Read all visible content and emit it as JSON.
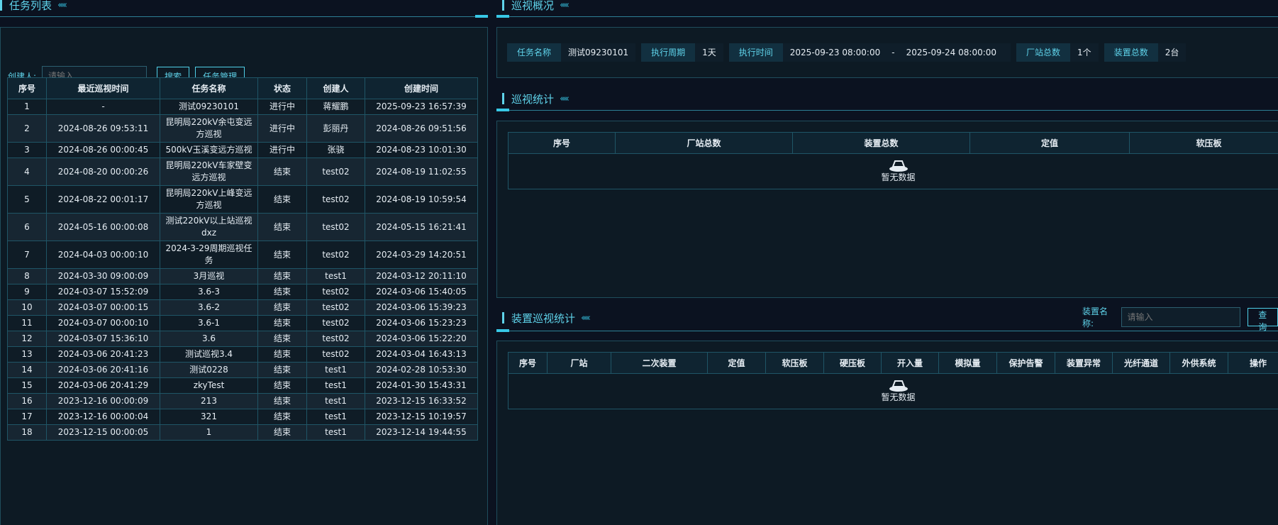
{
  "task_list": {
    "title": "任务列表",
    "creator_label": "创建人:",
    "creator_placeholder": "请输入",
    "search_label": "搜索",
    "manage_label": "任务管理",
    "columns": [
      "序号",
      "最近巡视时间",
      "任务名称",
      "状态",
      "创建人",
      "创建时间"
    ],
    "rows": [
      [
        "1",
        "-",
        "测试09230101",
        "进行中",
        "蒋耀鹏",
        "2025-09-23 16:57:39"
      ],
      [
        "2",
        "2024-08-26 09:53:11",
        "昆明局220kV余屯变远方巡视",
        "进行中",
        "彭丽丹",
        "2024-08-26 09:51:56"
      ],
      [
        "3",
        "2024-08-26 00:00:45",
        "500kV玉溪变远方巡视",
        "进行中",
        "张骁",
        "2024-08-23 10:01:30"
      ],
      [
        "4",
        "2024-08-20 00:00:26",
        "昆明局220kV车家壁变远方巡视",
        "结束",
        "test02",
        "2024-08-19 11:02:55"
      ],
      [
        "5",
        "2024-08-22 00:01:17",
        "昆明局220kV上峰变远方巡视",
        "结束",
        "test02",
        "2024-08-19 10:59:54"
      ],
      [
        "6",
        "2024-05-16 00:00:08",
        "测试220kV以上站巡视dxz",
        "结束",
        "test02",
        "2024-05-15 16:21:41"
      ],
      [
        "7",
        "2024-04-03 00:00:10",
        "2024-3-29周期巡视任务",
        "结束",
        "test02",
        "2024-03-29 14:20:51"
      ],
      [
        "8",
        "2024-03-30 09:00:09",
        "3月巡视",
        "结束",
        "test1",
        "2024-03-12 20:11:10"
      ],
      [
        "9",
        "2024-03-07 15:52:09",
        "3.6-3",
        "结束",
        "test02",
        "2024-03-06 15:40:05"
      ],
      [
        "10",
        "2024-03-07 00:00:15",
        "3.6-2",
        "结束",
        "test02",
        "2024-03-06 15:39:23"
      ],
      [
        "11",
        "2024-03-07 00:00:10",
        "3.6-1",
        "结束",
        "test02",
        "2024-03-06 15:23:23"
      ],
      [
        "12",
        "2024-03-07 15:36:10",
        "3.6",
        "结束",
        "test02",
        "2024-03-06 15:22:20"
      ],
      [
        "13",
        "2024-03-06 20:41:23",
        "测试巡视3.4",
        "结束",
        "test02",
        "2024-03-04 16:43:13"
      ],
      [
        "14",
        "2024-03-06 20:41:16",
        "测试0228",
        "结束",
        "test1",
        "2024-02-28 10:53:30"
      ],
      [
        "15",
        "2024-03-06 20:41:29",
        "zkyTest",
        "结束",
        "test1",
        "2024-01-30 15:43:31"
      ],
      [
        "16",
        "2023-12-16 00:00:09",
        "213",
        "结束",
        "test1",
        "2023-12-15 16:33:52"
      ],
      [
        "17",
        "2023-12-16 00:00:04",
        "321",
        "结束",
        "test1",
        "2023-12-15 10:19:57"
      ],
      [
        "18",
        "2023-12-15 00:00:05",
        "1",
        "结束",
        "test1",
        "2023-12-14 19:44:55"
      ]
    ]
  },
  "overview": {
    "title": "巡视概况",
    "task_name_label": "任务名称",
    "task_name": "测试09230101",
    "period_label": "执行周期",
    "period": "1天",
    "exec_time_label": "执行时间",
    "exec_start": "2025-09-23 08:00:00",
    "exec_sep": "-",
    "exec_end": "2025-09-24 08:00:00",
    "station_label": "厂站总数",
    "station_count": "1个",
    "device_label": "装置总数",
    "device_count": "2台"
  },
  "stats": {
    "title": "巡视统计",
    "columns": [
      "序号",
      "厂站总数",
      "装置总数",
      "定值",
      "软压板"
    ],
    "empty_text": "暂无数据"
  },
  "device_stats": {
    "title": "装置巡视统计",
    "device_name_label": "装置名称:",
    "device_name_placeholder": "请输入",
    "query_label": "查询",
    "columns": [
      "序号",
      "厂站",
      "二次装置",
      "定值",
      "软压板",
      "硬压板",
      "开入量",
      "模拟量",
      "保护告警",
      "装置异常",
      "光纤通道",
      "外供系统",
      "操作"
    ],
    "empty_text": "暂无数据"
  },
  "colors": {
    "accent": "#5fd3ea",
    "background": "#0b1220",
    "panel": "#0d1a24",
    "border": "#1f5566"
  },
  "icons": [
    "empty-box-icon",
    "chevrons-decoration-icon"
  ]
}
